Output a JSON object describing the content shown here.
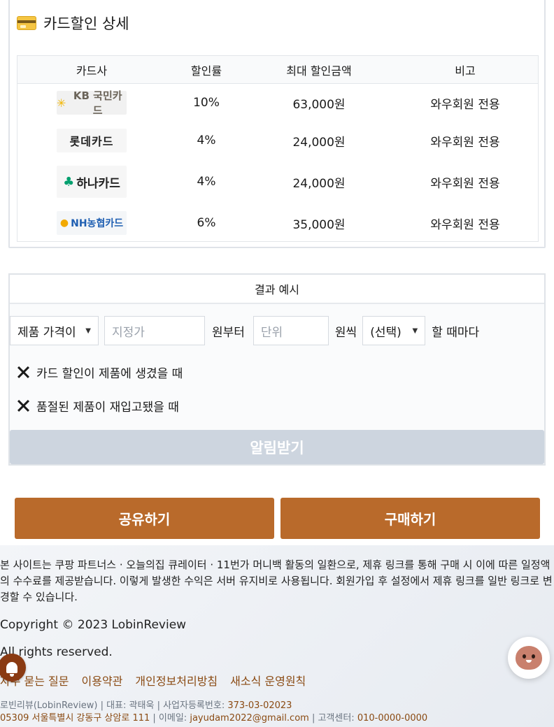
{
  "card_section": {
    "title": "카드할인 상세",
    "icon": "credit-card-icon",
    "headers": [
      "카드사",
      "할인률",
      "최대 할인금액",
      "비고"
    ],
    "rows": [
      {
        "card": "KB국민카드",
        "logo_text": "KB 국민카드",
        "rate": "10%",
        "max": "63,000원",
        "note": "와우회원 전용"
      },
      {
        "card": "롯데카드",
        "logo_text": "롯데카드",
        "rate": "4%",
        "max": "24,000원",
        "note": "와우회원 전용"
      },
      {
        "card": "하나카드",
        "logo_text": "하나카드",
        "rate": "4%",
        "max": "24,000원",
        "note": "와우회원 전용"
      },
      {
        "card": "NH농협카드",
        "logo_text": "NH농협카드",
        "rate": "6%",
        "max": "35,000원",
        "note": "와우회원 전용"
      }
    ]
  },
  "result_section": {
    "title": "결과 예시",
    "price_select": "제품 가격이",
    "fixed_price_placeholder": "지정가",
    "from_label": "원부터",
    "unit_placeholder": "단위",
    "each_label": "원씩",
    "choice_select": "(선택)",
    "when_label": "할 때마다",
    "option_card_discount": "카드 할인이 제품에 생겼을 때",
    "option_restock": "품절된 제품이 재입고됐을 때",
    "alert_button": "알림받기"
  },
  "actions": {
    "share": "공유하기",
    "buy": "구매하기"
  },
  "footer": {
    "notice": "본 사이트는 쿠팡 파트너스 · 오늘의집 큐레이터 · 11번가 머니백 활동의 일환으로, 제휴 링크를 통해 구매 시 이에 따른 일정액의 수수료를 제공받습니다. 이렇게 발생한 수익은 서버 유지비로 사용됩니다. 회원가입 후 설정에서 제휴 링크를 일반 링크로 변경할 수 있습니다.",
    "copyright": "Copyright © 2023 LobinReview",
    "rights": "All rights reserved.",
    "links": [
      "자주 묻는 질문",
      "이용약관",
      "개인정보처리방침",
      "새소식 운영원칙"
    ],
    "company": "로빈리뷰(LobinReview)",
    "ceo_label": "대표:",
    "ceo": "곽태욱",
    "biz_label": "사업자등록번호:",
    "biz_no": "373-03-02023",
    "address": "05309 서울특별시 강동구 상암로 111",
    "email_label": "이메일:",
    "email": "jayudam2022@gmail.com",
    "cs_label": "고객센터:",
    "cs_phone": "010-0000-0000"
  },
  "floating": {
    "bell_icon": "notification-bell-icon",
    "chat_icon": "chat-character-icon"
  }
}
